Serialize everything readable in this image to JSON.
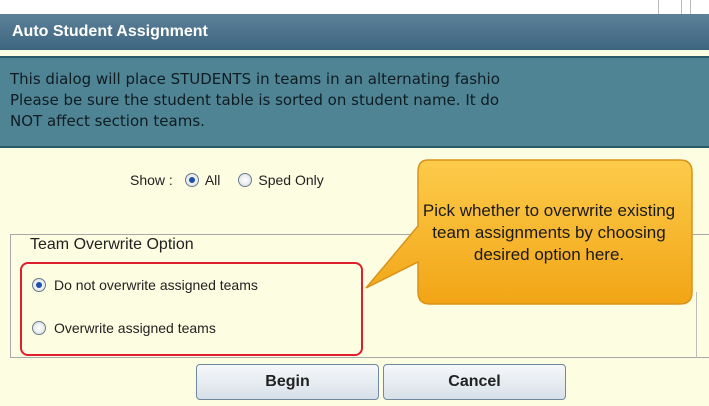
{
  "dialog": {
    "title": "Auto Student Assignment",
    "info_lines": [
      "This dialog will place STUDENTS in teams in an alternating fashio",
      "Please be sure the student table is sorted on student name. It do",
      "NOT affect section teams."
    ]
  },
  "show": {
    "label": "Show :",
    "options": [
      {
        "label": "All",
        "selected": true
      },
      {
        "label": "Sped Only",
        "selected": false
      }
    ]
  },
  "overwrite": {
    "legend": "Team Overwrite Option",
    "options": [
      {
        "label": "Do not overwrite assigned teams",
        "selected": true
      },
      {
        "label": "Overwrite assigned teams",
        "selected": false
      }
    ]
  },
  "buttons": {
    "begin": "Begin",
    "cancel": "Cancel"
  },
  "callout": {
    "text": "Pick whether to overwrite existing team assignments by choosing desired option here."
  },
  "colors": {
    "titlebar": "#4a7088",
    "info_bg": "#4f8494",
    "dialog_bg": "#fdfde1",
    "callout_fill": "#f6b01e",
    "highlight": "#e01e2d"
  }
}
